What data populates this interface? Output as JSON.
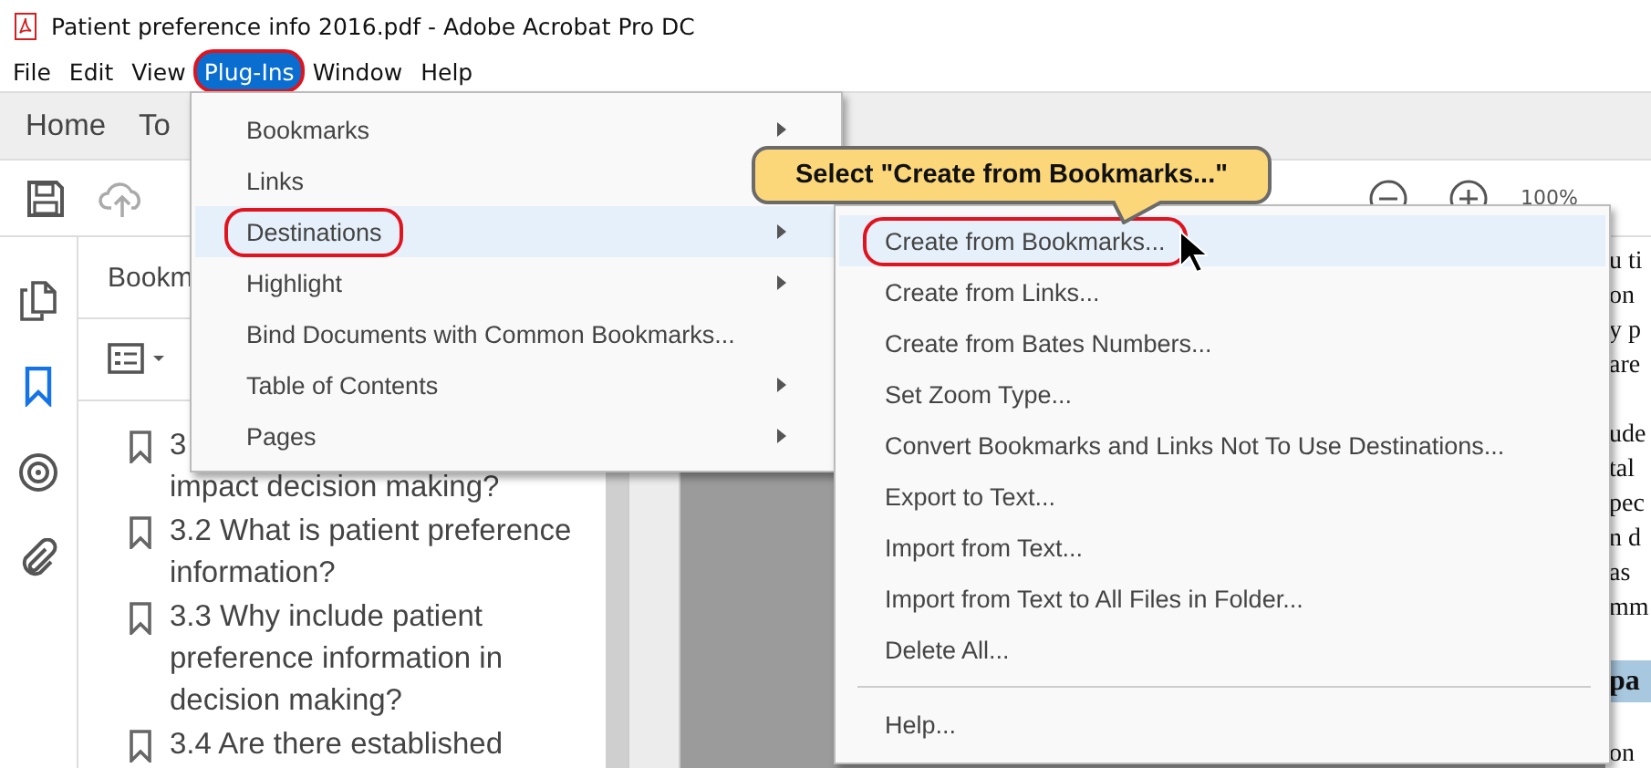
{
  "window": {
    "title": "Patient preference info 2016.pdf - Adobe Acrobat Pro DC"
  },
  "menu_bar": [
    {
      "label": "File",
      "selected": false,
      "circled": false
    },
    {
      "label": "Edit",
      "selected": false,
      "circled": false
    },
    {
      "label": "View",
      "selected": false,
      "circled": false
    },
    {
      "label": "Plug-Ins",
      "selected": true,
      "circled": true
    },
    {
      "label": "Window",
      "selected": false,
      "circled": false
    },
    {
      "label": "Help",
      "selected": false,
      "circled": false
    }
  ],
  "tabs": [
    {
      "label": "Home"
    },
    {
      "label": "To"
    }
  ],
  "zoom": {
    "value": "100%"
  },
  "bookmarks_panel": {
    "title": "Bookm",
    "items": [
      {
        "lines": [
          "3",
          "impact decision making?"
        ]
      },
      {
        "lines": [
          "3.2 What is patient preference",
          "information?"
        ]
      },
      {
        "lines": [
          "3.3 Why include patient",
          "preference information in",
          "decision making?"
        ]
      },
      {
        "lines": [
          "3.4 Are there established"
        ]
      }
    ]
  },
  "document": {
    "paragraphs": [
      {
        "kind": "text",
        "lines": [
          "u ti",
          "on",
          "y p",
          "are"
        ]
      },
      {
        "kind": "text",
        "lines": [
          "ude",
          "tal",
          "pec",
          "n d",
          "as",
          "mm"
        ]
      },
      {
        "kind": "heading",
        "lines": [
          "pa"
        ]
      },
      {
        "kind": "text",
        "lines": [
          "on"
        ]
      }
    ]
  },
  "plugins_menu": [
    {
      "label": "Bookmarks",
      "has_submenu": true,
      "selected": false,
      "circled": false
    },
    {
      "label": "Links",
      "selected": false,
      "circled": false
    },
    {
      "label": "Destinations",
      "has_submenu": true,
      "selected": true,
      "circled": true
    },
    {
      "label": "Highlight",
      "has_submenu": true,
      "selected": false,
      "circled": false
    },
    {
      "label": "Bind Documents with Common Bookmarks...",
      "has_submenu": false,
      "selected": false,
      "circled": false
    },
    {
      "label": "Table of Contents",
      "has_submenu": true,
      "selected": false,
      "circled": false
    },
    {
      "label": "Pages",
      "has_submenu": true,
      "selected": false,
      "circled": false
    }
  ],
  "destinations_submenu": [
    {
      "kind": "item",
      "label": "Create from Bookmarks...",
      "selected": true,
      "circled": true
    },
    {
      "kind": "item",
      "label": "Create from Links...",
      "selected": false,
      "circled": false
    },
    {
      "kind": "item",
      "label": "Create from Bates Numbers...",
      "selected": false,
      "circled": false
    },
    {
      "kind": "item",
      "label": "Set Zoom Type...",
      "selected": false,
      "circled": false
    },
    {
      "kind": "item",
      "label": "Convert Bookmarks and Links Not To Use Destinations...",
      "selected": false,
      "circled": false
    },
    {
      "kind": "item",
      "label": "Export to Text...",
      "selected": false,
      "circled": false
    },
    {
      "kind": "item",
      "label": "Import from Text...",
      "selected": false,
      "circled": false
    },
    {
      "kind": "item",
      "label": "Import from Text to All Files in Folder...",
      "selected": false,
      "circled": false
    },
    {
      "kind": "item",
      "label": "Delete All...",
      "selected": false,
      "circled": false
    },
    {
      "kind": "separator"
    },
    {
      "kind": "item",
      "label": "Help...",
      "selected": false,
      "circled": false
    }
  ],
  "callout": {
    "text": "Select \"Create from Bookmarks...\""
  }
}
